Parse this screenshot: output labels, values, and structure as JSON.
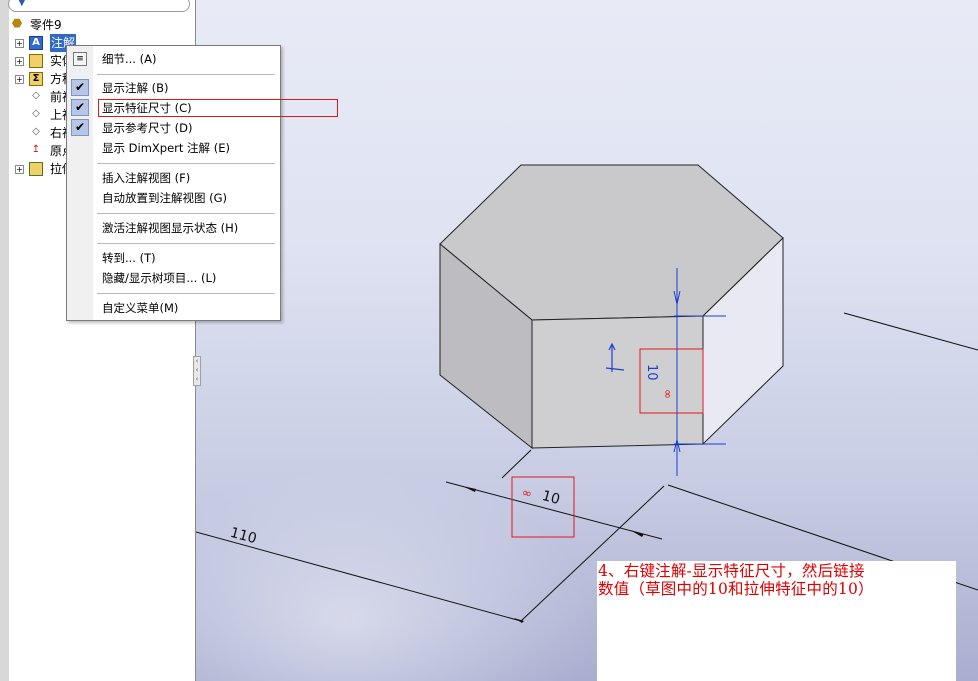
{
  "feature_tree": {
    "filter_icon": "filter-icon",
    "root": {
      "label": "零件9",
      "icon": "part-icon"
    },
    "items": [
      {
        "label": "注解",
        "icon": "annotations-icon",
        "expandable": true,
        "selected": true
      },
      {
        "label": "实体",
        "icon": "solid-bodies-icon",
        "expandable": true
      },
      {
        "label": "方程",
        "icon": "equations-icon",
        "expandable": true
      },
      {
        "label": "前视",
        "icon": "plane-icon",
        "expandable": false
      },
      {
        "label": "上视",
        "icon": "plane-icon",
        "expandable": false
      },
      {
        "label": "右视",
        "icon": "plane-icon",
        "expandable": false
      },
      {
        "label": "原点",
        "icon": "origin-icon",
        "expandable": false
      },
      {
        "label": "拉伸",
        "icon": "extrude-icon",
        "expandable": true
      }
    ]
  },
  "context_menu": {
    "items": [
      {
        "label": "细节... (A)",
        "icon": "details-icon",
        "checked": false
      },
      {
        "label": "显示注解 (B)",
        "checked": true
      },
      {
        "label": "显示特征尺寸 (C)",
        "checked": true,
        "highlighted": true
      },
      {
        "label": "显示参考尺寸 (D)",
        "checked": true
      },
      {
        "label": "显示 DimXpert 注解 (E)",
        "checked": false
      },
      {
        "label": "插入注解视图 (F)",
        "checked": false
      },
      {
        "label": "自动放置到注解视图 (G)",
        "checked": false
      },
      {
        "label": "激活注解视图显示状态 (H)",
        "checked": false
      },
      {
        "label": "转到... (T)",
        "checked": false
      },
      {
        "label": "隐藏/显示树项目... (L)",
        "checked": false
      },
      {
        "label": "自定义菜单(M)",
        "checked": false
      }
    ]
  },
  "viewport": {
    "dimension_height": "10",
    "dimension_sketch": "10",
    "dimension_length": "110",
    "link_symbol": "∞",
    "colors": {
      "dimension_blue": "#1a3fd0",
      "highlight_red": "#e01818",
      "face_top": "#c9c9cc",
      "face_front": "#cfcfd2",
      "face_left": "#bdbdc1",
      "face_right": "#e9e9f4"
    }
  },
  "instruction_note": {
    "line1": "4、右键注解-显示特征尺寸，然后链接",
    "line2": "数值（草图中的10和拉伸特征中的10）"
  }
}
